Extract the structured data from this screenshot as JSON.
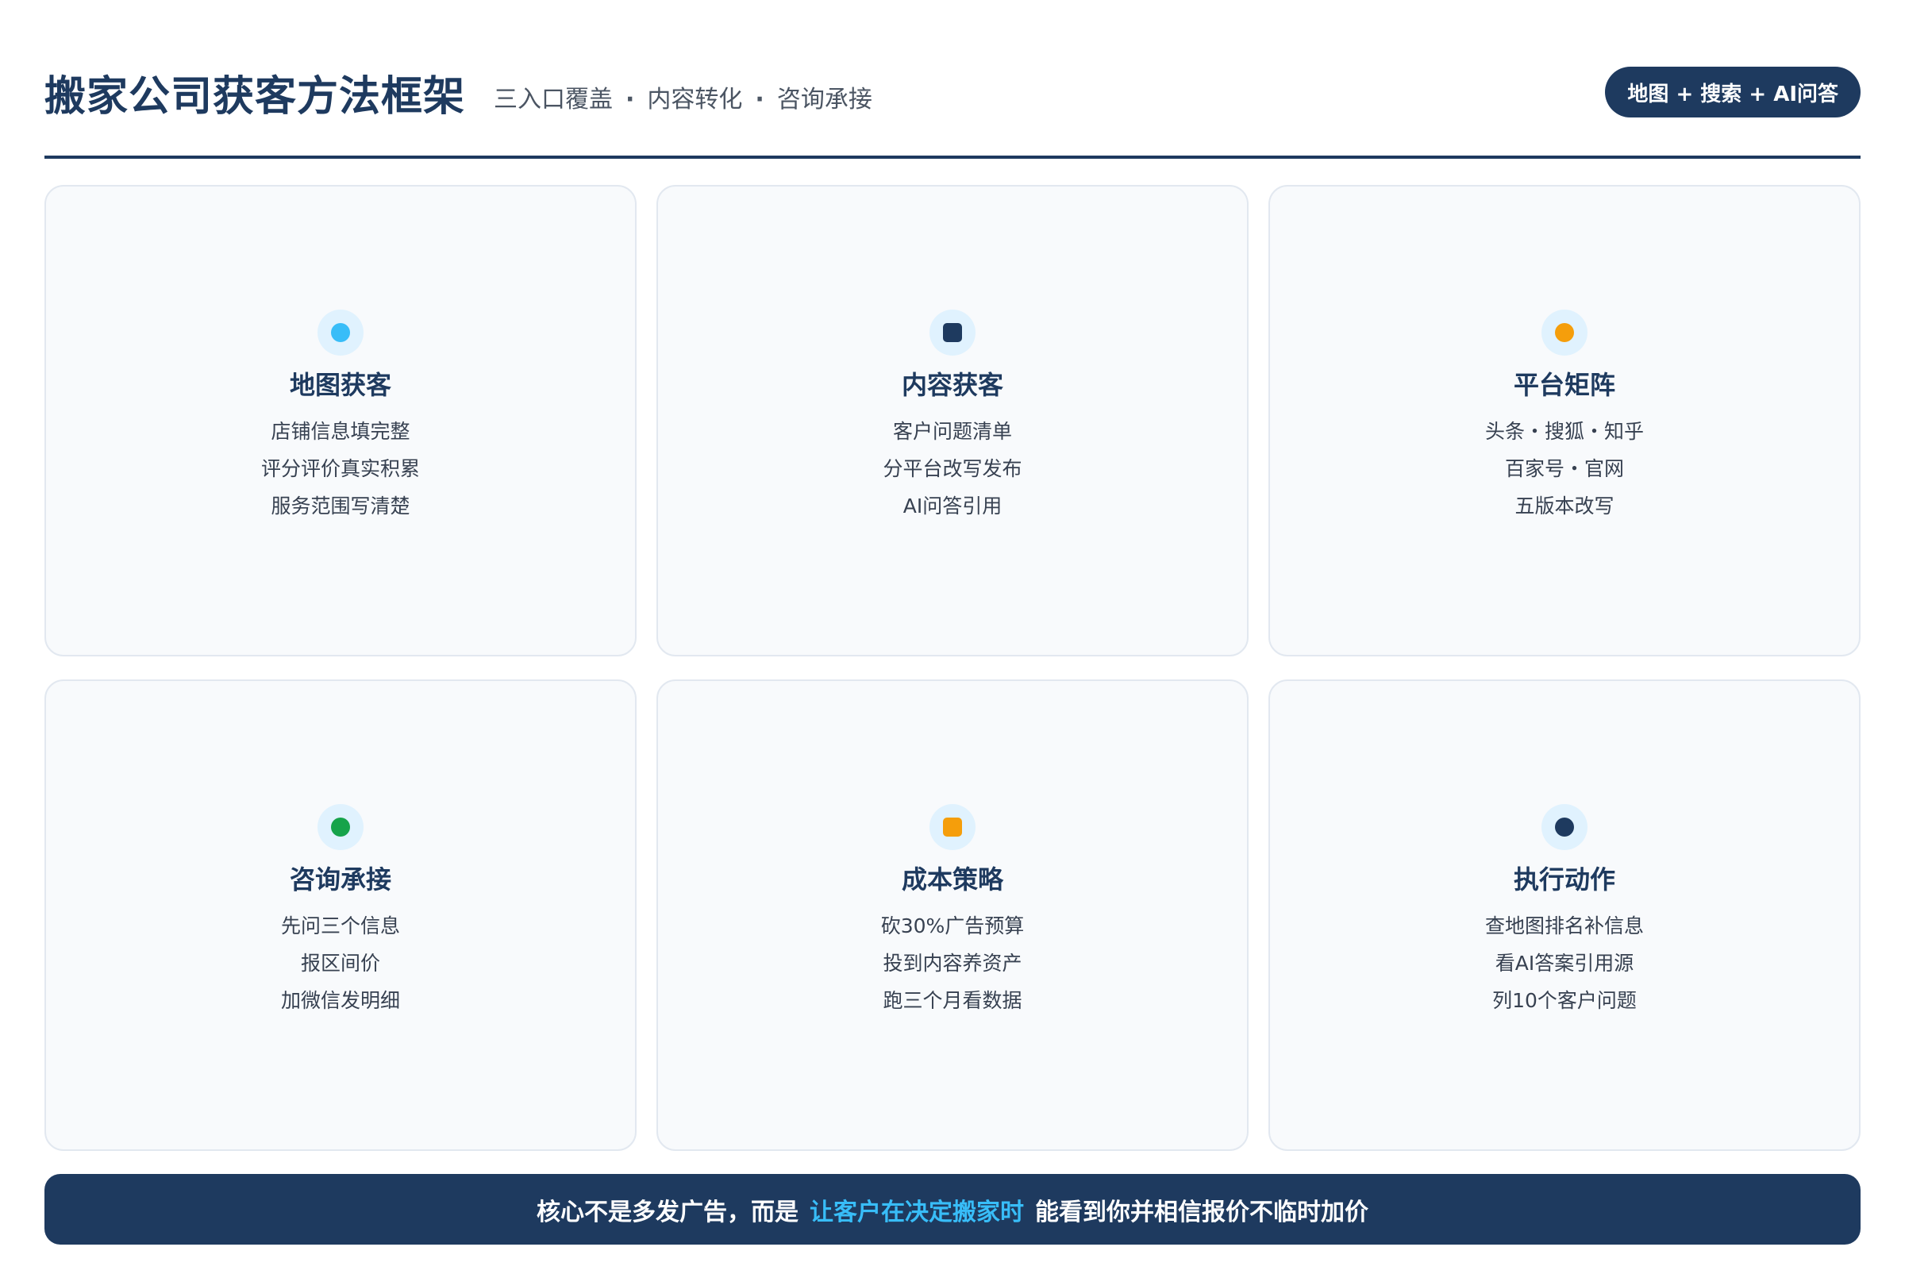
{
  "header": {
    "title": "搬家公司获客方法框架",
    "subtitle_parts": [
      "三入口覆盖",
      "内容转化",
      "咨询承接"
    ],
    "subtitle_separator": "·",
    "badge": "地图 + 搜索 + AI问答"
  },
  "cards": [
    {
      "title": "地图获客",
      "icon": "circle-icon",
      "icon_color": "#38bdf8",
      "lines": [
        "店铺信息填完整",
        "评分评价真实积累",
        "服务范围写清楚"
      ]
    },
    {
      "title": "内容获客",
      "icon": "square-icon",
      "icon_color": "#1e3a5f",
      "lines": [
        "客户问题清单",
        "分平台改写发布",
        "AI问答引用"
      ]
    },
    {
      "title": "平台矩阵",
      "icon": "circle-icon",
      "icon_color": "#f59e0b",
      "lines": [
        "头条・搜狐・知乎",
        "百家号・官网",
        "五版本改写"
      ]
    },
    {
      "title": "咨询承接",
      "icon": "circle-icon",
      "icon_color": "#16a34a",
      "lines": [
        "先问三个信息",
        "报区间价",
        "加微信发明细"
      ]
    },
    {
      "title": "成本策略",
      "icon": "square-icon",
      "icon_color": "#f59e0b",
      "lines": [
        "砍30%广告预算",
        "投到内容养资产",
        "跑三个月看数据"
      ]
    },
    {
      "title": "执行动作",
      "icon": "circle-icon",
      "icon_color": "#1e3a5f",
      "lines": [
        "查地图排名补信息",
        "看AI答案引用源",
        "列10个客户问题"
      ]
    }
  ],
  "banner": {
    "prefix": "核心不是多发广告，而是",
    "highlight": "让客户在决定搬家时",
    "suffix": "能看到你并相信报价不临时加价"
  },
  "colors": {
    "primary": "#1e3a5f",
    "highlight": "#38bdf8"
  }
}
